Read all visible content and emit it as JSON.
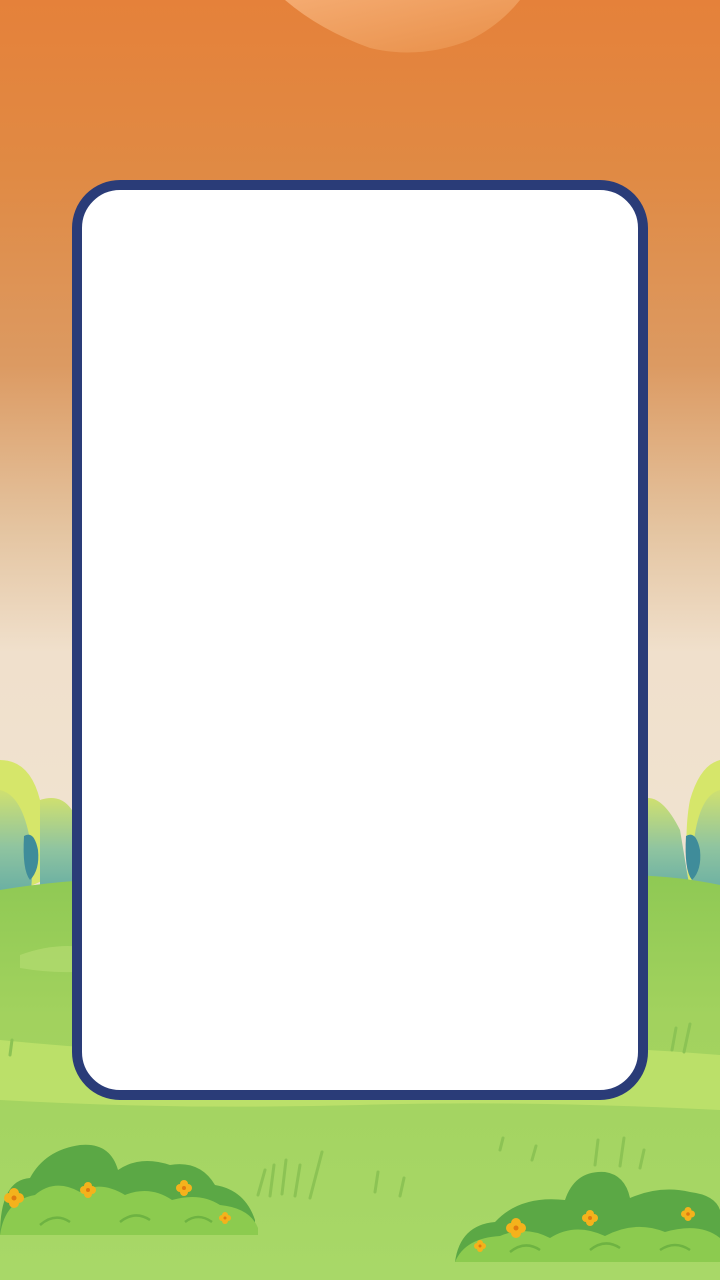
{
  "colors": {
    "sky_top": "#e58136",
    "sky_bottom": "#f1e3cc",
    "grass": "#9bcd58",
    "grass_light": "#c2e36a",
    "bush_dark": "#5ba845",
    "bush_light": "#8ccb4f",
    "flower": "#f4b21c",
    "frame_border": "#2a3c78",
    "frame_fill": "#ffffff"
  },
  "frame": {
    "content": ""
  }
}
